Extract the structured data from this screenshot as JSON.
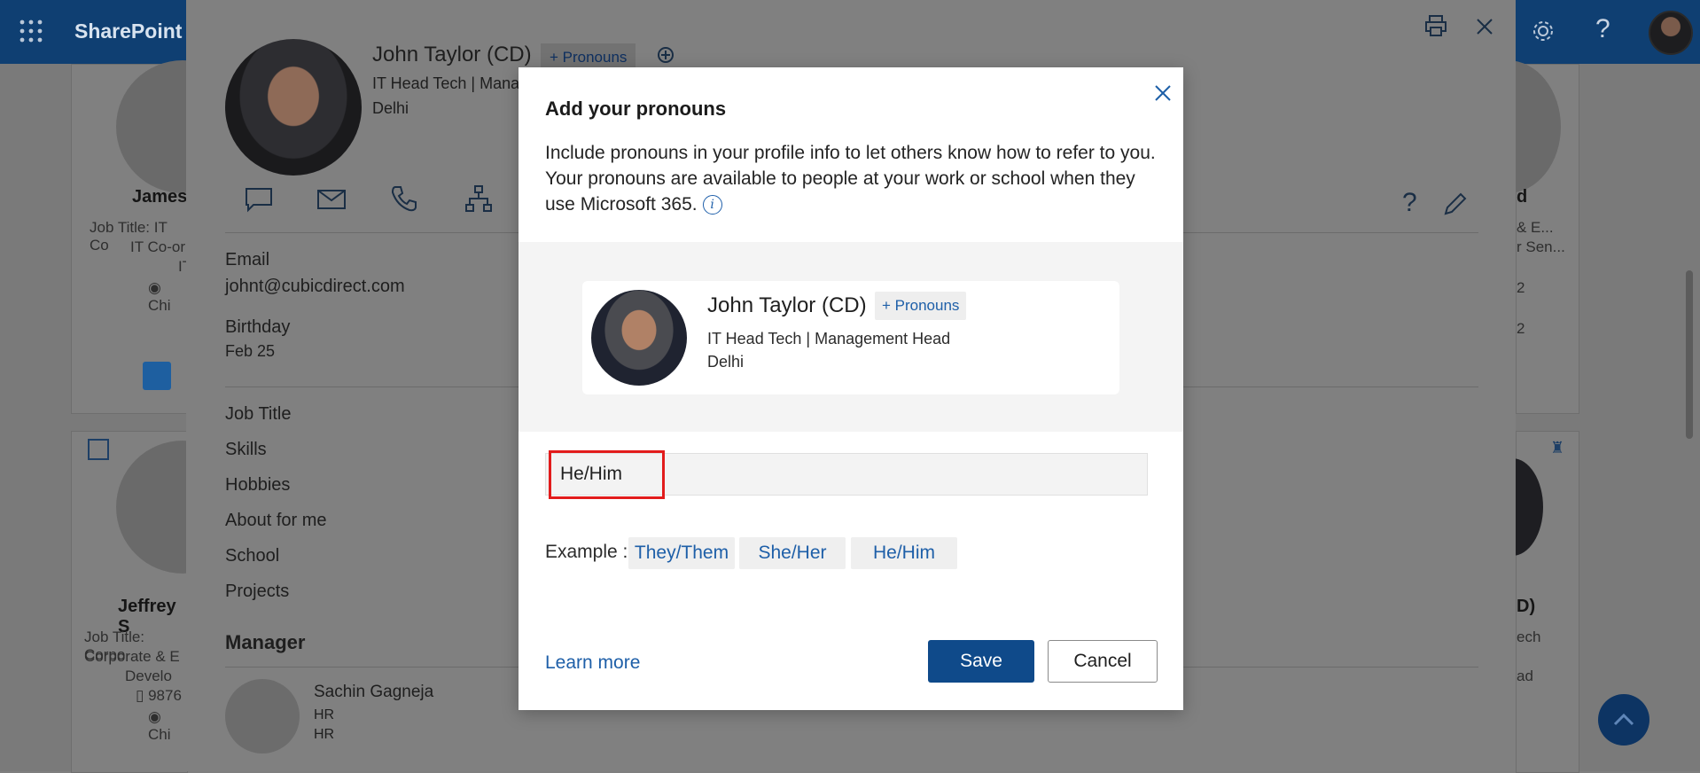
{
  "topbar": {
    "brand": "SharePoint"
  },
  "background": {
    "cards": [
      {
        "name": "James",
        "lines": [
          "Job Title: IT Co",
          "IT Co-or",
          "IT",
          "Chi"
        ]
      },
      {
        "name": "Jeffrey S",
        "lines": [
          "Job Title: Corpo",
          "Corporate & E",
          "Develo",
          "9876",
          "Chi"
        ]
      }
    ],
    "right_fragments": [
      "d",
      "& E...",
      "r Sen...",
      "2",
      "2",
      "D)",
      "ech",
      "ad"
    ]
  },
  "profile": {
    "name": "John Taylor (CD)",
    "pronouns_chip": "+ Pronouns",
    "title": "IT Head Tech | Mana",
    "location": "Delhi",
    "email_label": "Email",
    "email_value": "johnt@cubicdirect.com",
    "birthday_label": "Birthday",
    "birthday_value": "Feb 25",
    "fields": [
      "Job Title",
      "Skills",
      "Hobbies",
      "About for me",
      "School",
      "Projects"
    ],
    "manager_heading": "Manager",
    "manager": {
      "name": "Sachin Gagneja",
      "line1": "HR",
      "line2": "HR"
    }
  },
  "modal": {
    "title": "Add your pronouns",
    "description": "Include pronouns in your profile info to let others know how to refer to you. Your pronouns are available to people at your work or school when they use Microsoft 365.",
    "info_icon_glyph": "i",
    "preview": {
      "name": "John Taylor (CD)",
      "pronouns_chip": "+ Pronouns",
      "title": "IT Head Tech | Management Head",
      "location": "Delhi"
    },
    "input_value": "He/Him",
    "example_label": "Example :",
    "examples": [
      "They/Them",
      "She/Her",
      "He/Him"
    ],
    "learn_more": "Learn more",
    "save_label": "Save",
    "cancel_label": "Cancel"
  },
  "colors": {
    "suite_bar": "#0f3f72",
    "accent": "#0f4a8a",
    "link": "#1e5fa8",
    "highlight": "#e21c1c"
  }
}
